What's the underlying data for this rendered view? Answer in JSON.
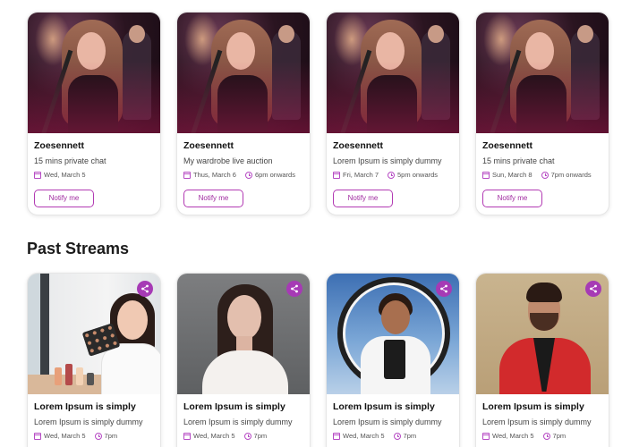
{
  "upcoming": [
    {
      "name": "Zoesennett",
      "description": "15 mins private chat",
      "date": "Wed, March 5",
      "time": "",
      "button": "Notify me"
    },
    {
      "name": "Zoesennett",
      "description": "My wardrobe live auction",
      "date": "Thus, March 6",
      "time": "6pm onwards",
      "button": "Notify me"
    },
    {
      "name": "Zoesennett",
      "description": "Lorem Ipsum is simply dummy",
      "date": "Fri, March 7",
      "time": "5pm onwards",
      "button": "Notify me"
    },
    {
      "name": "Zoesennett",
      "description": "15 mins private chat",
      "date": "Sun, March 8",
      "time": "7pm onwards",
      "button": "Notify me"
    }
  ],
  "past_title": "Past Streams",
  "past": [
    {
      "name": "Lorem Ipsum is simply",
      "description": "Lorem Ipsum is simply dummy",
      "date": "Wed, March 5",
      "time": "7pm",
      "image": "makeup"
    },
    {
      "name": "Lorem Ipsum is simply",
      "description": "Lorem Ipsum is simply dummy",
      "date": "Wed, March 5",
      "time": "7pm",
      "image": "portrait"
    },
    {
      "name": "Lorem Ipsum is simply",
      "description": "Lorem Ipsum is simply dummy",
      "date": "Wed, March 5",
      "time": "7pm",
      "image": "ringlight"
    },
    {
      "name": "Lorem Ipsum is simply",
      "description": "Lorem Ipsum is simply dummy",
      "date": "Wed, March 5",
      "time": "7pm",
      "image": "redsuit"
    }
  ],
  "icons": {
    "date": "calendar-icon",
    "time": "clock-icon",
    "share": "share-icon"
  },
  "colors": {
    "accent": "#a63ab5",
    "text": "#111111"
  }
}
